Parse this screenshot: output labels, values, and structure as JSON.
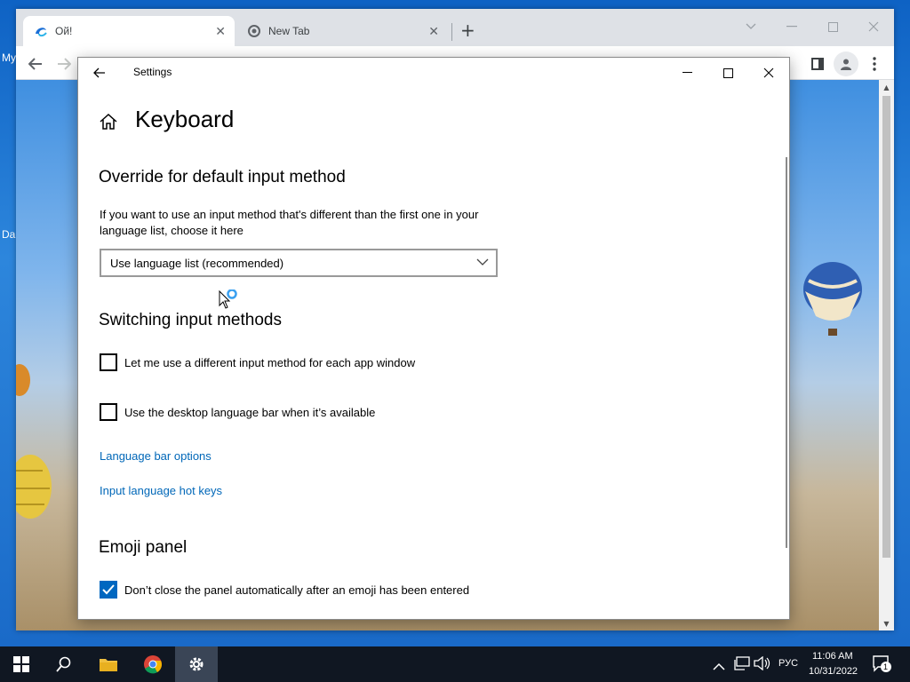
{
  "desktop": {
    "icon_labels": [
      "My",
      "Da"
    ]
  },
  "browser": {
    "tabs": [
      {
        "title": "Ой!",
        "active": true
      },
      {
        "title": "New Tab",
        "active": false
      }
    ],
    "new_tab_symbol": "+",
    "toolbar_icons": [
      "back-arrow-icon",
      "forward-arrow-icon",
      "sidebar-icon",
      "profile-icon",
      "menu-dots-icon"
    ]
  },
  "settings": {
    "window_title": "Settings",
    "page_title": "Keyboard",
    "sections": {
      "override": {
        "heading": "Override for default input method",
        "description": "If you want to use an input method that's different than the first one in your language list, choose it here",
        "dropdown_value": "Use language list (recommended)"
      },
      "switching": {
        "heading": "Switching input methods",
        "checkbox1": {
          "label": "Let me use a different input method for each app window",
          "checked": false
        },
        "checkbox2": {
          "label": "Use the desktop language bar when it’s available",
          "checked": false
        },
        "link1": "Language bar options",
        "link2": "Input language hot keys"
      },
      "emoji": {
        "heading": "Emoji panel",
        "checkbox": {
          "label": "Don’t close the panel automatically after an emoji has been entered",
          "checked": true
        }
      }
    },
    "colors": {
      "accent": "#0067c0",
      "link": "#0067b8"
    }
  },
  "taskbar": {
    "items": [
      "start-icon",
      "search-icon",
      "file-explorer-icon",
      "chrome-icon",
      "settings-icon"
    ],
    "active_item": "settings-icon",
    "language": "РУС",
    "time": "11:06 AM",
    "date": "10/31/2022",
    "notification_count": "1"
  }
}
